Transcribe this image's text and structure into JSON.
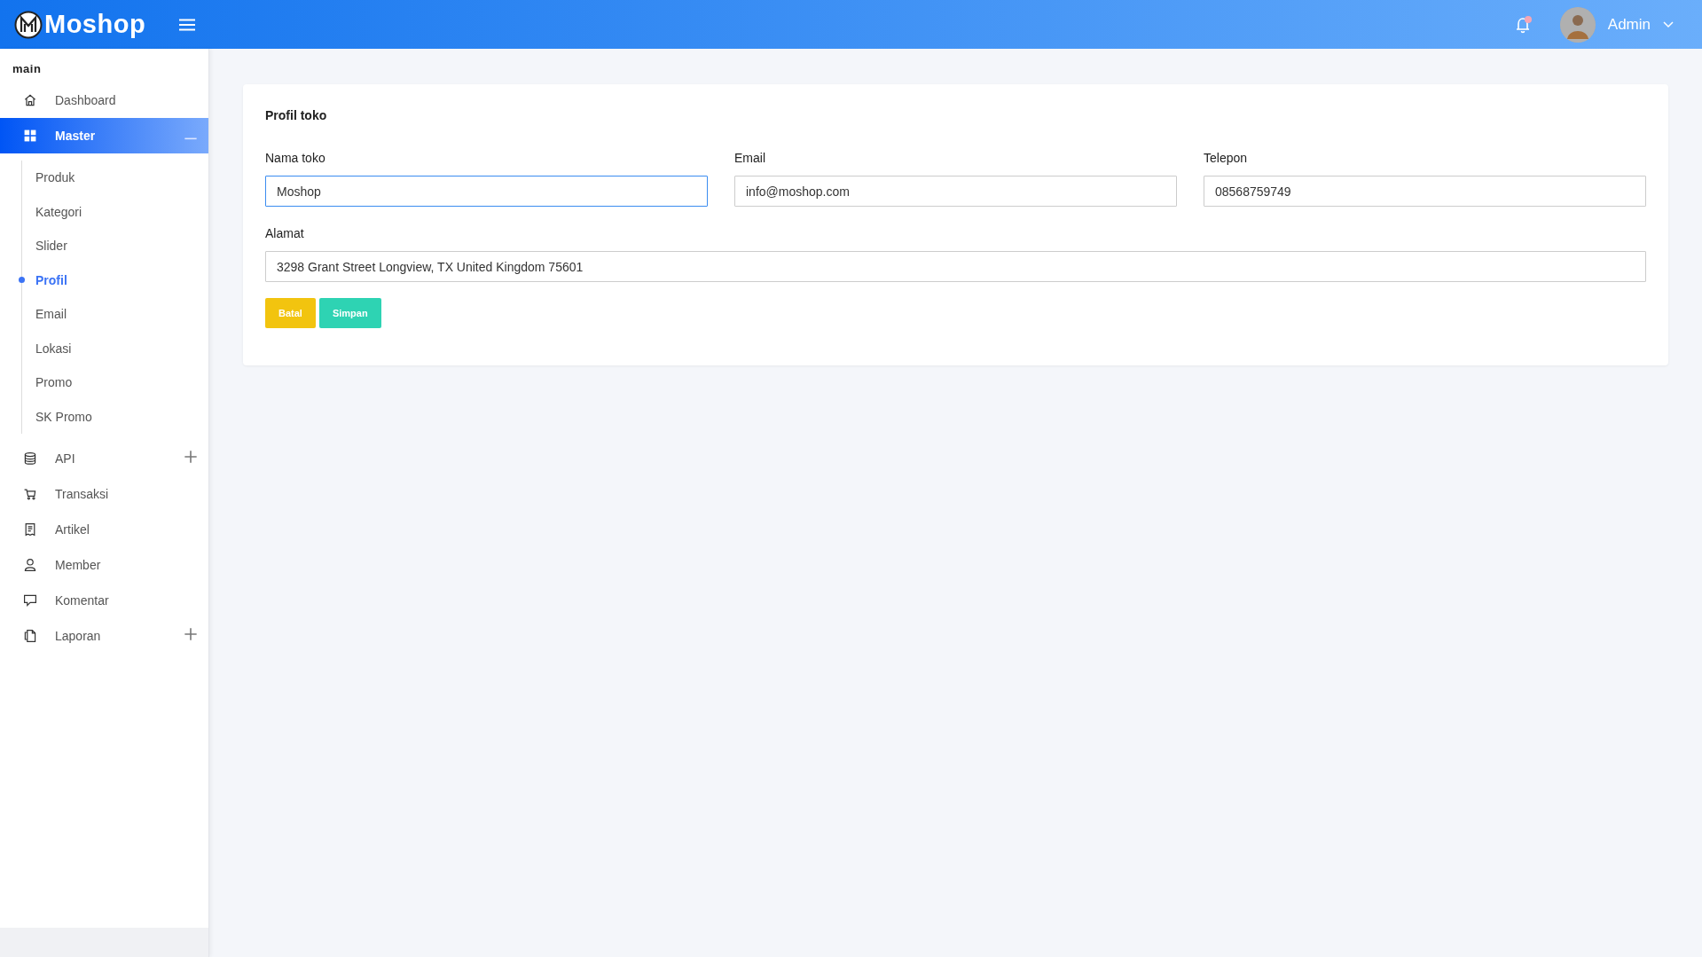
{
  "header": {
    "brand": "Moshop",
    "user": {
      "name": "Admin"
    }
  },
  "sidebar": {
    "section": "main",
    "items": [
      {
        "kind": "link",
        "label": "Dashboard",
        "selected": false
      },
      {
        "kind": "group",
        "label": "Master",
        "selected": true,
        "expanded": true,
        "children": [
          {
            "label": "Produk",
            "selected": false
          },
          {
            "label": "Kategori",
            "selected": false
          },
          {
            "label": "Slider",
            "selected": false
          },
          {
            "label": "Profil",
            "selected": true
          },
          {
            "label": "Email",
            "selected": false
          },
          {
            "label": "Lokasi",
            "selected": false
          },
          {
            "label": "Promo",
            "selected": false
          },
          {
            "label": "SK Promo",
            "selected": false
          }
        ]
      },
      {
        "kind": "group",
        "label": "API",
        "selected": false,
        "expanded": false
      },
      {
        "kind": "link",
        "label": "Transaksi",
        "selected": false
      },
      {
        "kind": "link",
        "label": "Artikel",
        "selected": false
      },
      {
        "kind": "link",
        "label": "Member",
        "selected": false
      },
      {
        "kind": "link",
        "label": "Komentar",
        "selected": false
      },
      {
        "kind": "group",
        "label": "Laporan",
        "selected": false,
        "expanded": false
      }
    ]
  },
  "card": {
    "title": "Profil toko",
    "fields": [
      {
        "label": "Nama toko",
        "value": "Moshop",
        "focused": true
      },
      {
        "label": "Email",
        "value": "info@moshop.com",
        "focused": false
      },
      {
        "label": "Telepon",
        "value": "08568759749",
        "focused": false
      },
      {
        "label": "Alamat",
        "value": "3298 Grant Street Longview, TX United Kingdom 75601",
        "focused": false
      }
    ],
    "buttons": [
      {
        "kind": "cancel",
        "label": "Batal"
      },
      {
        "kind": "save",
        "label": "Simpan"
      }
    ]
  }
}
